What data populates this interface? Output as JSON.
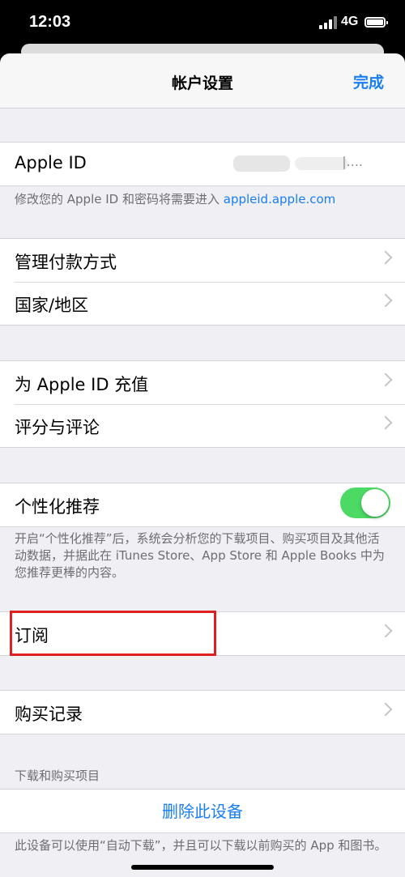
{
  "status_bar": {
    "time": "12:03",
    "network": "4G"
  },
  "nav": {
    "title": "帐户设置",
    "done_label": "完成"
  },
  "apple_id": {
    "label": "Apple ID",
    "value_suffix": "|....",
    "note_prefix": "修改您的 Apple ID 和密码将需要进入 ",
    "note_link": "appleid.apple.com"
  },
  "payment_group": [
    {
      "label": "管理付款方式"
    },
    {
      "label": "国家/地区"
    }
  ],
  "topup_group": [
    {
      "label": "为 Apple ID 充值"
    },
    {
      "label": "评分与评论"
    }
  ],
  "personalization": {
    "label": "个性化推荐",
    "toggle_on": true,
    "note": "开启“个性化推荐”后，系统会分析您的下载项目、购买项目及其他活动数据，并据此在 iTunes Store、App Store 和 Apple Books 中为您推荐更棒的内容。"
  },
  "subscriptions": {
    "label": "订阅"
  },
  "purchase_history": {
    "label": "购买记录"
  },
  "downloads": {
    "header": "下载和购买项目",
    "remove_label": "删除此设备",
    "note": "此设备可以使用“自动下载”，并且可以下载以前购买的 App 和图书。"
  },
  "colors": {
    "accent": "#1a7ef2",
    "toggle_on": "#4cd964",
    "highlight": "#e02020"
  }
}
